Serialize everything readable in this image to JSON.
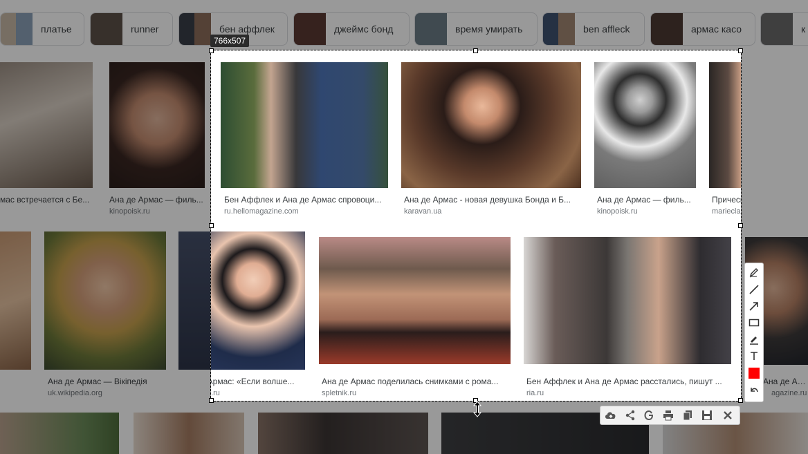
{
  "chips": [
    {
      "label": "платье"
    },
    {
      "label": "runner"
    },
    {
      "label": "бен аффлек"
    },
    {
      "label": "джеймс бонд"
    },
    {
      "label": "время умирать"
    },
    {
      "label": "ben affleck"
    },
    {
      "label": "армас касо"
    },
    {
      "label": "к"
    }
  ],
  "selection": {
    "size_label": "766x507"
  },
  "background_tiles": {
    "row1_left": {
      "caption": "мас встречается с Бе...",
      "source": ""
    },
    "row1_b": {
      "caption": "Ана де Армас — филь...",
      "source": "kinopoisk.ru"
    },
    "row2_b": {
      "caption": "Ана де Армас — Вікіпедія",
      "source": "uk.wikipedia.org"
    },
    "row2_right": {
      "caption": "Ана де Армас н",
      "source": "agazine.ru"
    }
  },
  "results": {
    "row1": [
      {
        "caption": "Бен Аффлек и Ана де Армас спровоци...",
        "source": "ru.hellomagazine.com"
      },
      {
        "caption": "Ана де Армас - новая девушка Бонда и Б...",
        "source": "karavan.ua"
      },
      {
        "caption": "Ана де Армас — филь...",
        "source": "kinopoisk.ru"
      },
      {
        "caption": "Прическа мести: После",
        "source": "marieclaire.ua"
      }
    ],
    "row2": [
      {
        "caption": "Ана де Армас: «Если волше...",
        "source": "womanhit.ru"
      },
      {
        "caption": "Ана де Армас поделилась снимками с рома...",
        "source": "spletnik.ru"
      },
      {
        "caption": "Бен Аффлек и Ана де Армас расстались, пишут ...",
        "source": "ria.ru"
      }
    ]
  },
  "tools": {
    "vertical": [
      "pen-icon",
      "line-icon",
      "arrow-icon",
      "rectangle-icon",
      "marker-icon",
      "text-icon",
      "color-swatch",
      "undo-icon"
    ],
    "horizontal": [
      "upload-icon",
      "share-icon",
      "google-search-icon",
      "print-icon",
      "copy-icon",
      "save-icon",
      "close-icon"
    ],
    "color": "#ff0000"
  }
}
